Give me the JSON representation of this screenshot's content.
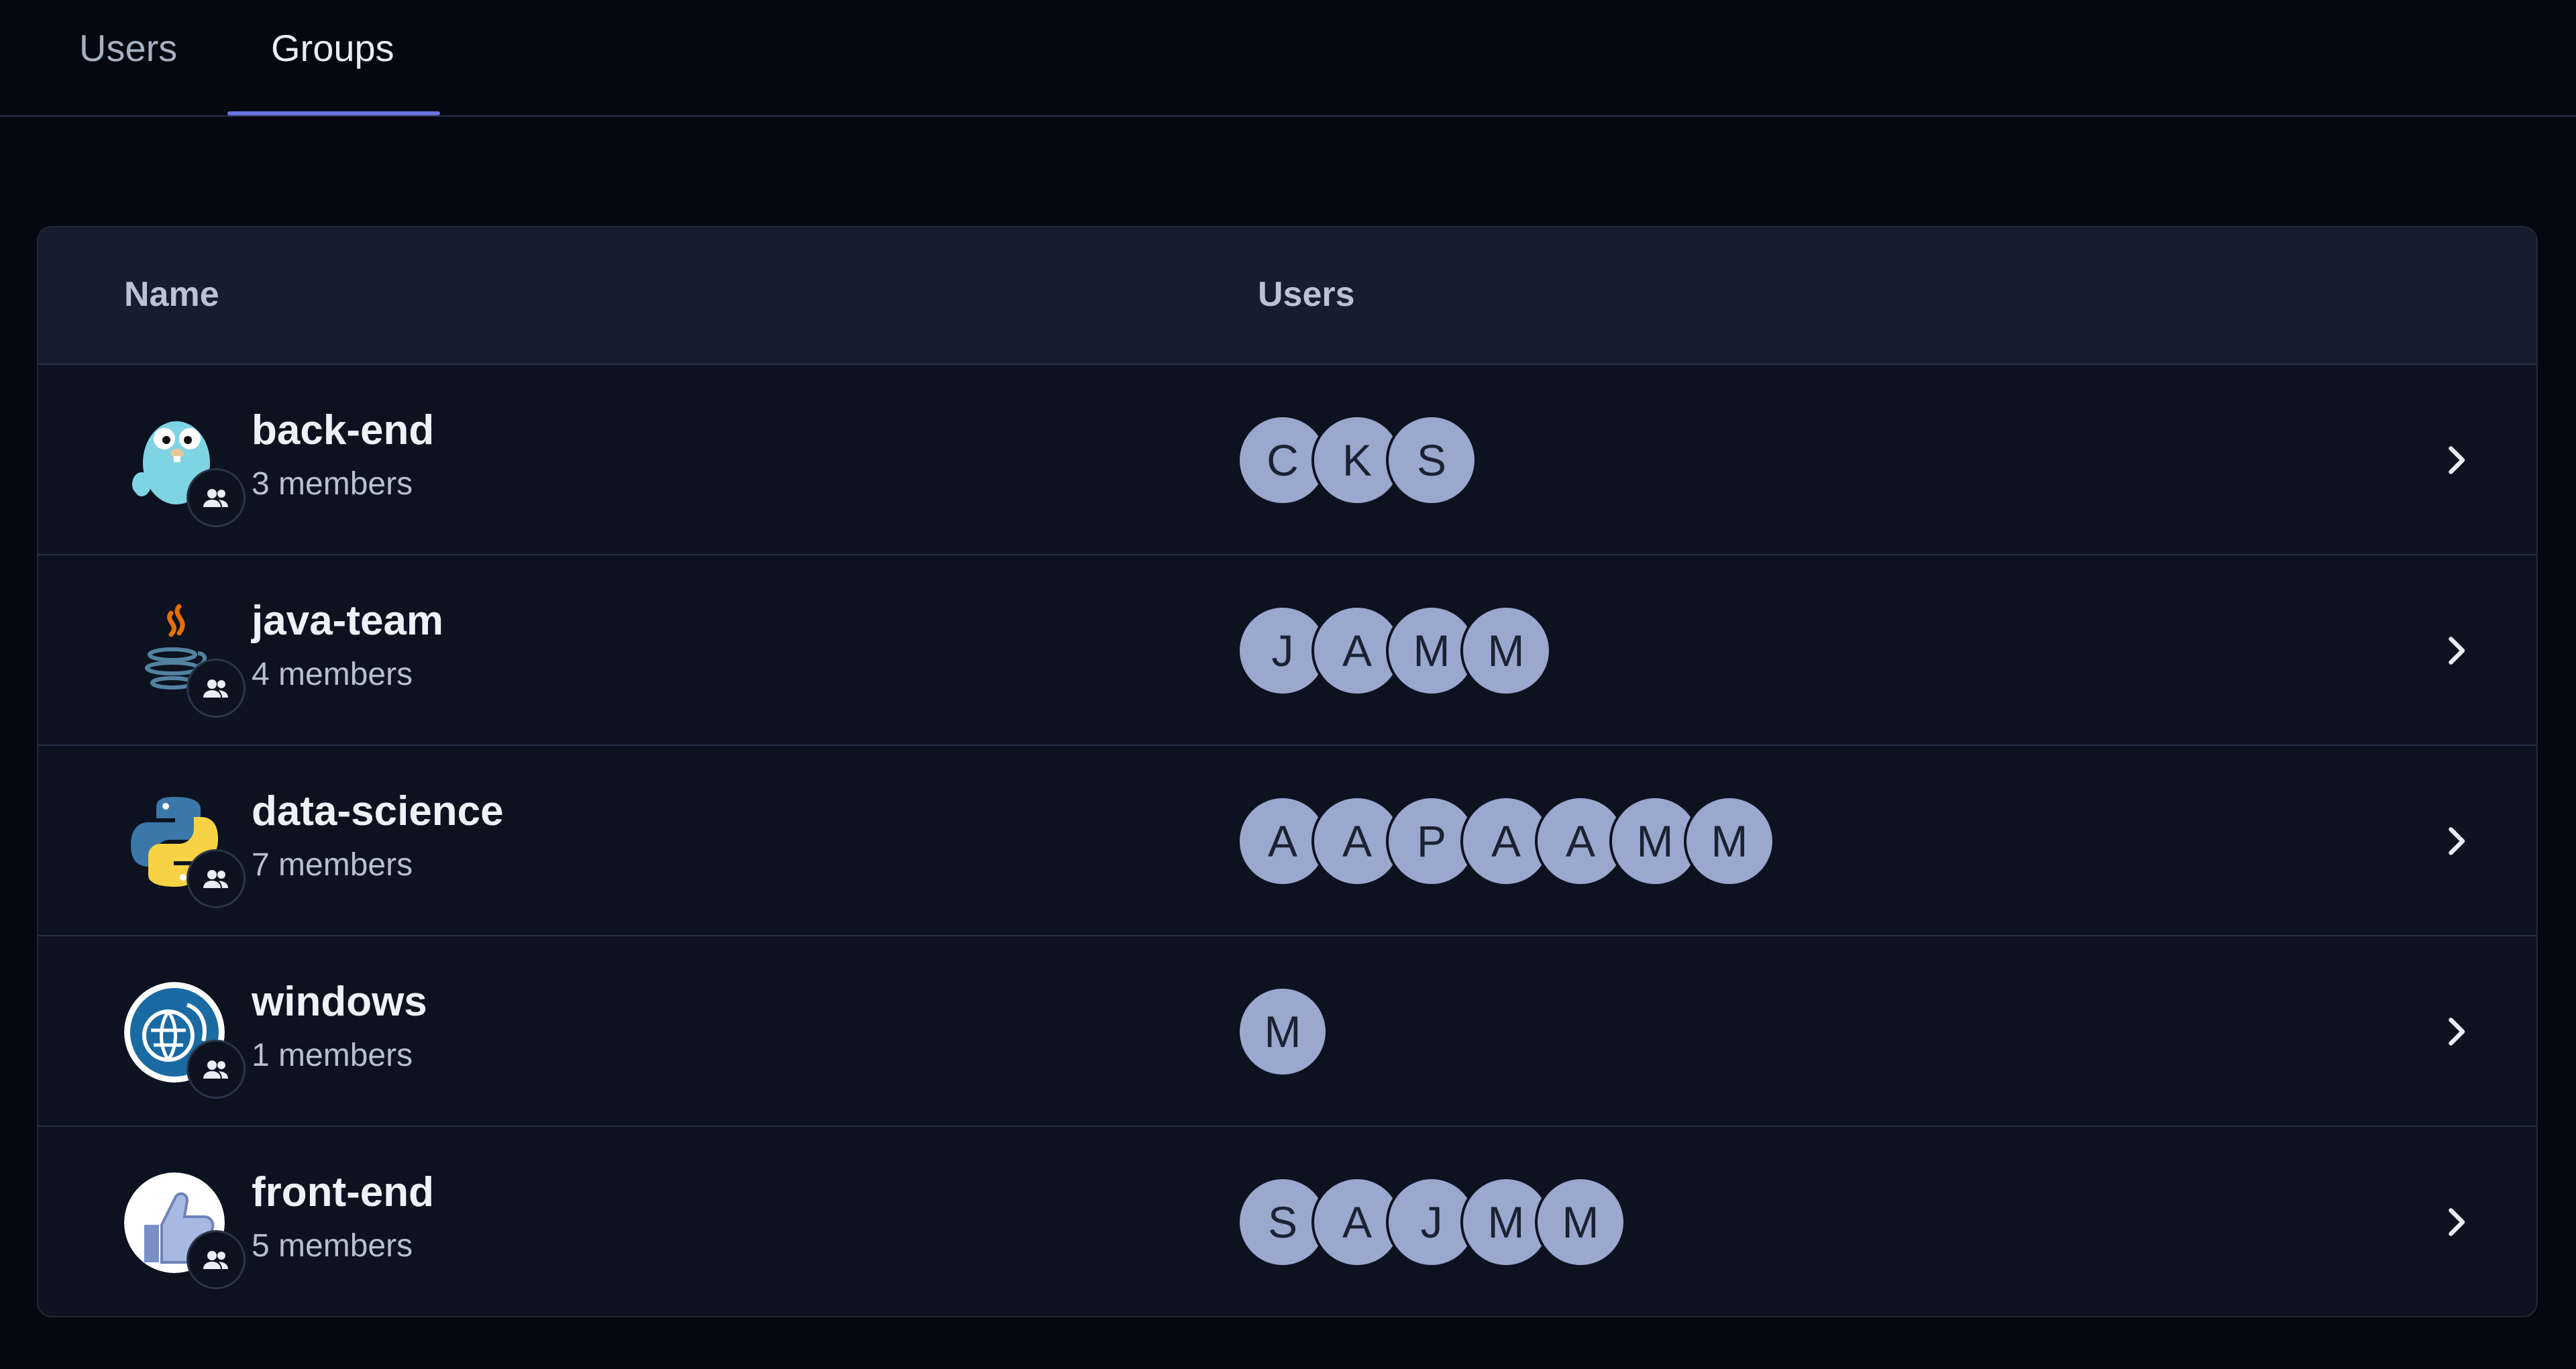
{
  "tabs": [
    {
      "label": "Users"
    },
    {
      "label": "Groups"
    }
  ],
  "table": {
    "headers": {
      "name": "Name",
      "users": "Users"
    },
    "rows": [
      {
        "name": "back-end",
        "members": "3 members",
        "icon": "gopher-icon",
        "users": [
          "C",
          "K",
          "S"
        ]
      },
      {
        "name": "java-team",
        "members": "4 members",
        "icon": "java-icon",
        "users": [
          "J",
          "A",
          "M",
          "M"
        ]
      },
      {
        "name": "data-science",
        "members": "7 members",
        "icon": "python-icon",
        "users": [
          "A",
          "A",
          "P",
          "A",
          "A",
          "M",
          "M"
        ]
      },
      {
        "name": "windows",
        "members": "1 members",
        "icon": "globe-icon",
        "users": [
          "M"
        ]
      },
      {
        "name": "front-end",
        "members": "5 members",
        "icon": "thumbs-up-icon",
        "users": [
          "S",
          "A",
          "J",
          "M",
          "M"
        ]
      }
    ]
  },
  "colors": {
    "background": "#050810",
    "accent": "#6b73e0",
    "user_avatar": "#9aa8ce"
  }
}
